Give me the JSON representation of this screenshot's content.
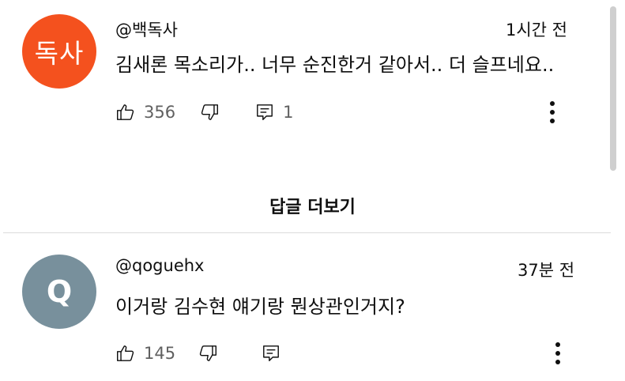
{
  "comments": [
    {
      "avatar_text": "독사",
      "avatar_color": "#f4511e",
      "handle": "@백독사",
      "time": "1시간 전",
      "text": "김새론 목소리가.. 너무 순진한거 같아서.. 더 슬프네요..",
      "likes": "356",
      "replies": "1"
    },
    {
      "avatar_text": "Q",
      "avatar_color": "#78909c",
      "handle": "@qoguehx",
      "time": "37분 전",
      "text": "이거랑 김수현 얘기랑 뭔상관인거지?",
      "likes": "145",
      "replies": ""
    }
  ],
  "more_replies_label": "답글 더보기",
  "icons": {
    "like": "thumbs-up-icon",
    "dislike": "thumbs-down-icon",
    "reply": "reply-icon",
    "more": "more-vert-icon"
  }
}
